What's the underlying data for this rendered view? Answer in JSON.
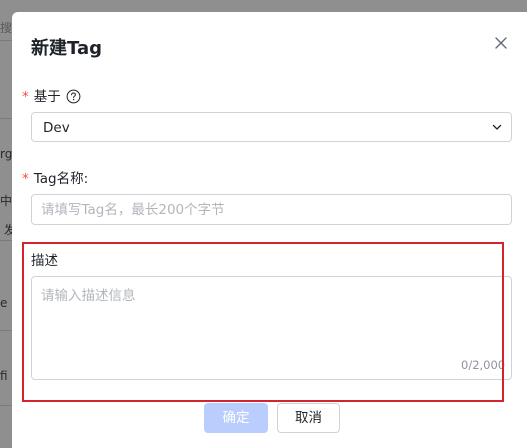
{
  "background": {
    "fragments": [
      "搜",
      "rge",
      "中",
      "发",
      "e n",
      "fi"
    ]
  },
  "modal": {
    "title": "新建Tag",
    "close_icon": "close-icon",
    "required_mark": "*",
    "base_field": {
      "label": "基于",
      "help_icon": "question-circle-icon",
      "value": "Dev",
      "chevron_icon": "chevron-down-icon"
    },
    "name_field": {
      "label": "Tag名称:",
      "placeholder": "请填写Tag名，最长200个字节",
      "value": ""
    },
    "description_field": {
      "label": "描述",
      "placeholder": "请输入描述信息",
      "value": "",
      "counter": "0/2,000"
    },
    "buttons": {
      "confirm": "确定",
      "cancel": "取消"
    }
  },
  "colors": {
    "primary_disabled": "#bacefd",
    "required": "#f54a45",
    "highlight": "#d3232d",
    "overlay": "#8f8f8f"
  }
}
